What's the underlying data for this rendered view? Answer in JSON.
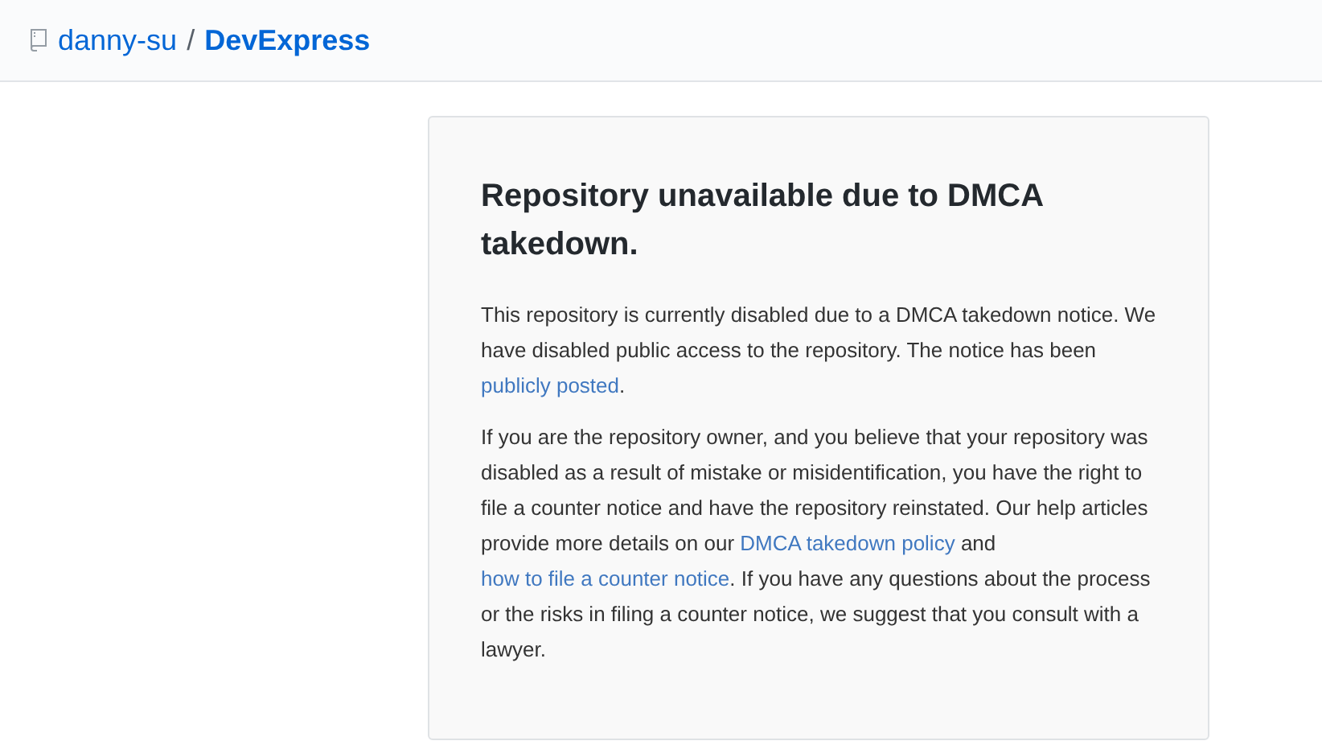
{
  "header": {
    "owner": "danny-su",
    "separator": "/",
    "repo": "DevExpress"
  },
  "notice": {
    "title": "Repository unavailable due to DMCA takedown.",
    "paragraphs": [
      {
        "parts": [
          {
            "kind": "text",
            "text": "This repository is currently disabled due to a DMCA takedown notice. We have disabled public access to the repository. The notice has been "
          },
          {
            "kind": "link",
            "text": "publicly posted"
          },
          {
            "kind": "text",
            "text": "."
          }
        ]
      },
      {
        "parts": [
          {
            "kind": "text",
            "text": "If you are the repository owner, and you believe that your repository was disabled as a result of mistake or misidentification, you have the right to file a counter notice and have the repository reinstated. Our help articles provide more details on our "
          },
          {
            "kind": "link",
            "text": "DMCA takedown policy"
          },
          {
            "kind": "text",
            "text": " and "
          },
          {
            "kind": "link",
            "text": "how to file a counter notice"
          },
          {
            "kind": "text",
            "text": ". If you have any questions about the process or the risks in filing a counter notice, we suggest that you consult with a lawyer."
          }
        ]
      }
    ]
  }
}
